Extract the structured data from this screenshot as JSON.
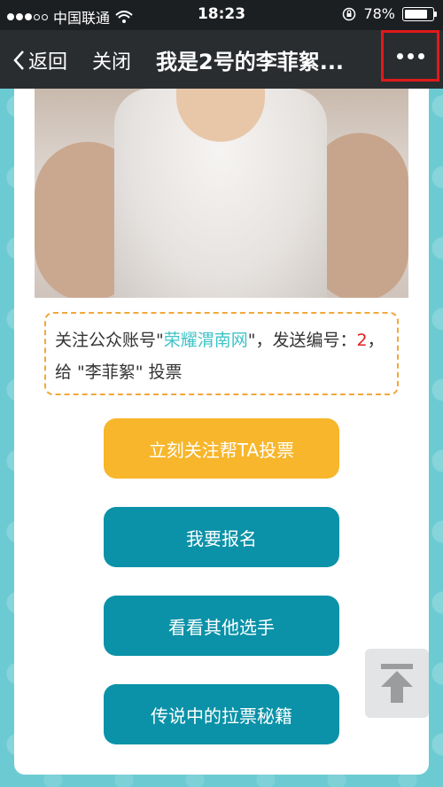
{
  "status_bar": {
    "carrier": "中国联通",
    "time": "18:23",
    "battery": "78%",
    "battery_level": 0.78
  },
  "nav": {
    "back_label": "返回",
    "close_label": "关闭",
    "title": "我是2号的李菲絮...",
    "more_icon": "more-dots-icon"
  },
  "notice": {
    "prefix": "关注公众账号\"",
    "account": "荣耀渭南网",
    "middle": "\"，发送编号：",
    "number": "2",
    "suffix": "，给 \"李菲絮\" 投票"
  },
  "buttons": {
    "follow_vote": "立刻关注帮TA投票",
    "signup": "我要报名",
    "others": "看看其他选手",
    "tips": "传说中的拉票秘籍"
  },
  "colors": {
    "accent_yellow": "#f7b62b",
    "accent_teal": "#0b92a8",
    "link": "#3fc3c7",
    "highlight_red": "#e02020"
  }
}
